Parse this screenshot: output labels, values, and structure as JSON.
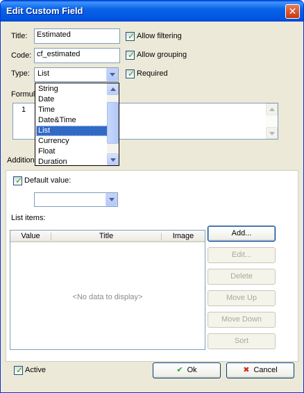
{
  "window": {
    "title": "Edit Custom Field",
    "close_symbol": "✕"
  },
  "form": {
    "title_label": "Title:",
    "title_value": "Estimated",
    "code_label": "Code:",
    "code_value": "cf_estimated",
    "type_label": "Type:",
    "type_value": "List",
    "formula_label": "Formul",
    "formula_line_number": "1",
    "additional_label": "Addition"
  },
  "options": {
    "allow_filtering": {
      "label": "Allow filtering",
      "checked": true
    },
    "allow_grouping": {
      "label": "Allow grouping",
      "checked": true
    },
    "required": {
      "label": "Required",
      "checked": true
    }
  },
  "type_dropdown": {
    "items": [
      "String",
      "Date",
      "Time",
      "Date&Time",
      "List",
      "Currency",
      "Float",
      "Duration"
    ],
    "selected": "List"
  },
  "additional": {
    "default_value_label": "Default value:",
    "default_value_checked": true,
    "default_value": "",
    "list_items_label": "List items:"
  },
  "grid": {
    "columns": [
      "Value",
      "Title",
      "Image"
    ],
    "empty_text": "<No data to display>"
  },
  "list_buttons": {
    "add": "Add...",
    "edit": "Edit...",
    "delete": "Delete",
    "move_up": "Move Up",
    "move_down": "Move Down",
    "sort": "Sort"
  },
  "footer": {
    "active_label": "Active",
    "active_checked": true,
    "ok": "Ok",
    "cancel": "Cancel"
  },
  "colors": {
    "titlebar": "#0054e3",
    "selection": "#316ac5",
    "ok_icon": "#21a121",
    "cancel_icon": "#d6261e"
  },
  "icons": {
    "checkmark": "checkmark-icon",
    "ok": "ok-check-icon",
    "cancel": "cancel-x-icon",
    "close": "close-icon"
  }
}
